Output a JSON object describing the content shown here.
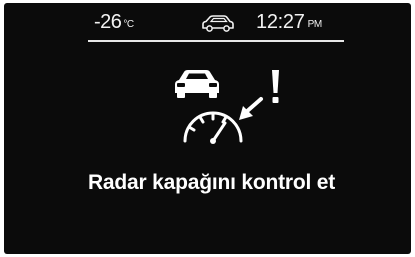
{
  "status_bar": {
    "temperature_value": "-26",
    "temperature_unit": "°C",
    "vehicle_icon": "car-outline-icon",
    "time_value": "12:27",
    "time_period": "PM"
  },
  "warning": {
    "icon": "radar-sensor-warning-icon",
    "message": "Radar kapağını kontrol et"
  },
  "colors": {
    "background": "#0b0b0b",
    "foreground": "#ffffff"
  }
}
